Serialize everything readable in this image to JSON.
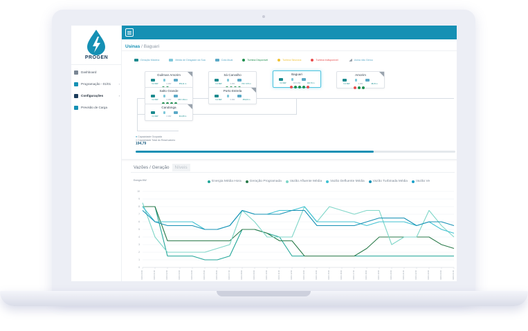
{
  "app": {
    "brand": "PROGEN"
  },
  "sidebar": {
    "items": [
      {
        "label": "Dashboard",
        "icon": "dashboard-icon",
        "chevron": ""
      },
      {
        "label": "Programação - 01/01",
        "icon": "list-icon",
        "chevron": "›"
      },
      {
        "label": "Configurações",
        "icon": "wrench-icon",
        "chevron": "›"
      },
      {
        "label": "Previsão de Carga",
        "icon": "forecast-icon",
        "chevron": ""
      }
    ]
  },
  "breadcrumb": {
    "section": "Usinas",
    "separator": " / ",
    "page": "Baguari"
  },
  "legend": [
    {
      "label": "Geração Máxima",
      "kind": "swatch",
      "color": "#1a8a8e"
    },
    {
      "label": "Média de Desgaste da Sua",
      "kind": "icon",
      "color": "#7fc8da"
    },
    {
      "label": "Cota Atual",
      "kind": "swatch",
      "color": "#5aa9c7"
    },
    {
      "label": "Turbina Disponível",
      "kind": "dot",
      "color": "#1f8f4e"
    },
    {
      "label": "Turbina Sincrona",
      "kind": "dot",
      "color": "#f1c232"
    },
    {
      "label": "Turbina Indisponível",
      "kind": "dot",
      "color": "#e84c4c"
    },
    {
      "label": "Usina não Gerou",
      "kind": "corner",
      "color": "#9aa3ad"
    }
  ],
  "plants": [
    {
      "name": "Guilman Amorim",
      "values": [
        "0,0 MW",
        "0 MW",
        "353,11 m"
      ],
      "dots": [
        "#1f8f4e",
        "#1f8f4e"
      ],
      "selected": false,
      "corner": true
    },
    {
      "name": "Sá Carvalho",
      "values": [
        "0,0 MW",
        "0 MW",
        "372 / 372 m"
      ],
      "dots": [
        "#1f8f4e",
        "#1f8f4e",
        "#1f8f4e",
        "#1f8f4e"
      ],
      "selected": false,
      "corner": false
    },
    {
      "name": "Baguari",
      "values": [
        "0,0 MW",
        "28,5 MW",
        "192,79 m"
      ],
      "dots": [
        "#e84c4c",
        "#1f8f4e",
        "#1f8f4e",
        "#1f8f4e",
        "#e84c4c"
      ],
      "selected": true,
      "corner": false
    },
    {
      "name": "Amorim",
      "values": [
        "0,0 MW",
        "0 MW",
        "38,15 m"
      ],
      "dots": [
        "#e84c4c",
        "#1f8f4e",
        "#1f8f4e"
      ],
      "selected": false,
      "corner": true
    },
    {
      "name": "Salto Grande",
      "values": [
        "0,0 MW",
        "0 MW",
        "263 / 261 m"
      ],
      "dots": [
        "#1f8f4e",
        "#1f8f4e",
        "#1f8f4e",
        "#1f8f4e"
      ],
      "selected": false,
      "corner": false
    },
    {
      "name": "Porto Estrela",
      "values": [
        "0,0 MW",
        "0 MW",
        "253,00 m"
      ],
      "dots": [],
      "selected": false,
      "corner": true
    },
    {
      "name": "Candonga",
      "values": [
        "0,0 MW",
        "0 MW",
        "311,08 m"
      ],
      "dots": [],
      "selected": false,
      "corner": true
    }
  ],
  "capacity": {
    "used_label": "Capacidade Ocupada",
    "total_label": "Capacidade Total do Reservatório",
    "value": "194,79",
    "fill_fraction": 0.745
  },
  "tabs": [
    "Vazões / Geração",
    "Níveis"
  ],
  "chart_data": {
    "type": "line",
    "ylabel": "Energia\nMW",
    "series": [
      {
        "name": "Energia Média Hora",
        "color": "#22a699",
        "values": [
          8,
          8,
          1.5,
          1.5,
          1.5,
          1,
          1,
          1.5,
          5,
          5,
          4.5,
          4,
          1.5,
          1.5,
          1.5,
          1.5,
          1.5,
          1.5,
          1.5,
          1.5,
          1.5,
          1.5,
          1.5,
          1.5,
          1.5,
          1.5
        ]
      },
      {
        "name": "Geração Programada",
        "color": "#2a7a4a",
        "values": [
          8,
          8,
          3.5,
          3.5,
          3.5,
          3.5,
          3.5,
          3.5,
          5,
          5,
          4.5,
          3.5,
          3.5,
          1.5,
          1.5,
          1.5,
          1.5,
          1.5,
          2.5,
          4,
          4,
          4,
          4,
          4,
          3,
          2.5
        ]
      },
      {
        "name": "Vazão Afluente Média",
        "color": "#7fd6c8",
        "values": [
          8.5,
          4,
          2,
          2,
          2,
          2,
          2.5,
          3,
          7.5,
          6,
          4,
          4,
          4,
          8,
          6,
          8,
          7.5,
          7,
          7.5,
          7.5,
          3,
          4,
          4,
          7.5,
          5.5,
          4
        ]
      },
      {
        "name": "Vazão Defluente Média",
        "color": "#3fc1d2",
        "values": [
          8,
          6,
          6,
          6,
          6,
          5,
          5,
          5.5,
          7.5,
          7,
          7,
          7.5,
          7.5,
          8,
          6,
          6,
          6,
          6,
          5.5,
          6,
          6,
          6,
          5.5,
          6,
          5,
          4.5
        ]
      },
      {
        "name": "Vazão Turbinada Média",
        "color": "#1590b4",
        "values": [
          7.5,
          6,
          5.5,
          5.5,
          5.5,
          5,
          5,
          5.5,
          7.5,
          7,
          7,
          7,
          7.5,
          7.5,
          5.5,
          5.5,
          5.5,
          5.5,
          6,
          6.5,
          6.5,
          6.5,
          5.5,
          6,
          6,
          5.5
        ]
      },
      {
        "name": "Vazão Ve",
        "color": "#1aa0c9",
        "values": []
      }
    ],
    "ylim": [
      0,
      10
    ],
    "y_ticks": [
      "10",
      "9",
      "8",
      "7",
      "6",
      "5",
      "4",
      "3",
      "2",
      "1",
      "0"
    ],
    "x_ticks": [
      "01/01 00:00",
      "01/01 01:00",
      "01/01 02:00",
      "01/01 03:00",
      "01/01 04:00",
      "01/01 05:00",
      "01/01 06:00",
      "01/01 07:00",
      "01/01 08:00",
      "01/01 09:00",
      "01/01 10:00",
      "01/01 11:00",
      "01/01 12:00",
      "01/01 13:00",
      "01/01 14:00",
      "01/01 15:00",
      "01/01 16:00",
      "01/01 17:00",
      "01/01 18:00",
      "01/01 19:00",
      "01/01 20:00",
      "01/01 21:00",
      "01/01 22:00",
      "01/01 23:00",
      "02/01 00:00",
      "02/01 01:00"
    ]
  }
}
